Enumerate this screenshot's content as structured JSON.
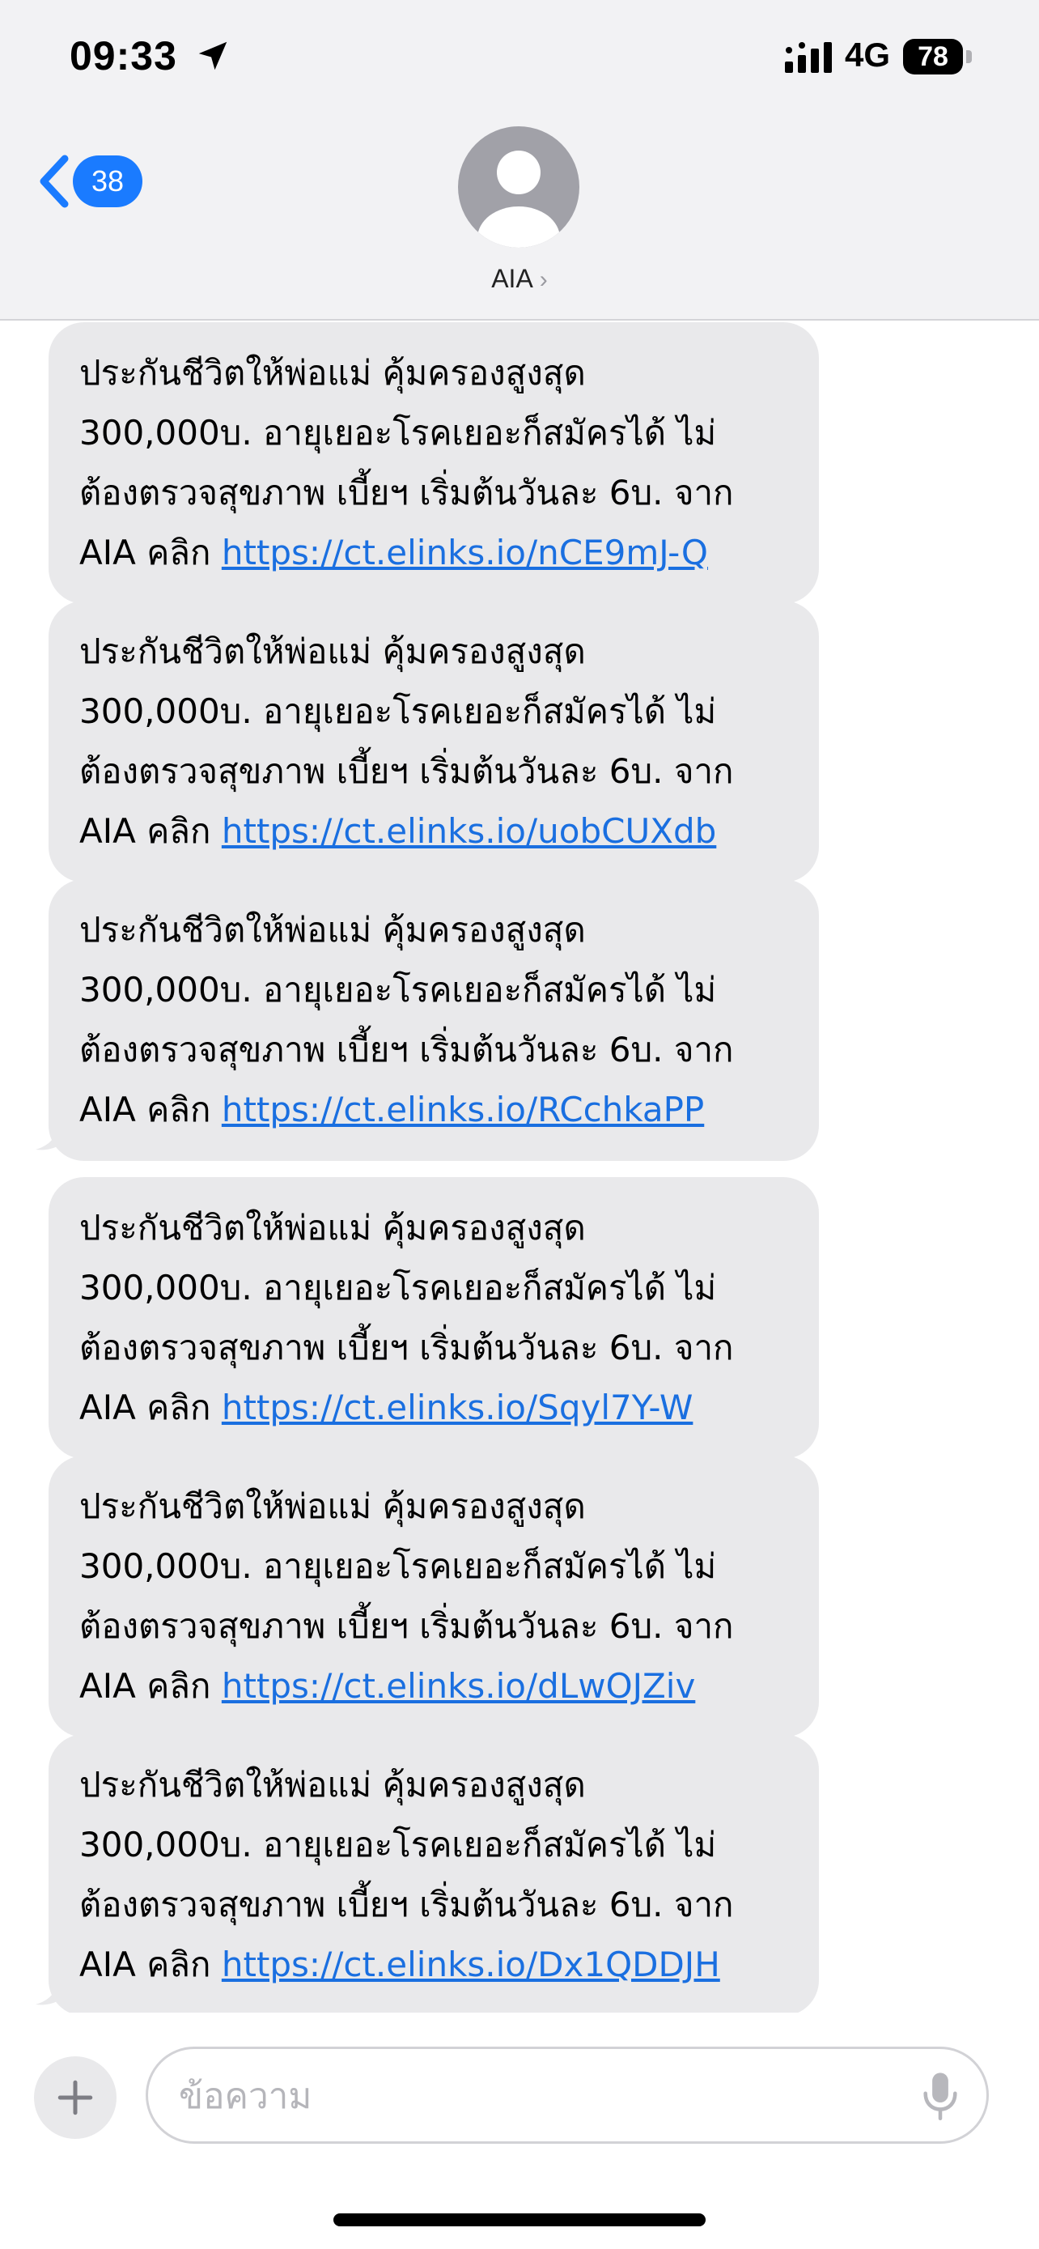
{
  "status_bar": {
    "time": "09:33",
    "network": "4G",
    "battery": "78"
  },
  "header": {
    "back_badge": "38",
    "contact_name": "AIA",
    "contact_chevron": "›"
  },
  "colors": {
    "accent": "#1a7bff",
    "bubble_gray": "#e9e9eb",
    "link": "#1a6fe0"
  },
  "messages": [
    {
      "line1": "ประกันชีวิตให้พ่อแม่ คุ้มครองสูงสุด",
      "line2": "300,000บ. อายุเยอะโรคเยอะก็สมัครได้ ไม่",
      "line3": "ต้องตรวจสุขภาพ เบี้ยฯ เริ่มต้นวันละ 6บ. จาก",
      "prefix": "AIA คลิก ",
      "link": "https://ct.elinks.io/nCE9mJ-Q"
    },
    {
      "line1": "ประกันชีวิตให้พ่อแม่ คุ้มครองสูงสุด",
      "line2": "300,000บ. อายุเยอะโรคเยอะก็สมัครได้ ไม่",
      "line3": "ต้องตรวจสุขภาพ เบี้ยฯ เริ่มต้นวันละ 6บ. จาก",
      "prefix": "AIA คลิก ",
      "link": "https://ct.elinks.io/uobCUXdb"
    },
    {
      "line1": "ประกันชีวิตให้พ่อแม่ คุ้มครองสูงสุด",
      "line2": "300,000บ. อายุเยอะโรคเยอะก็สมัครได้ ไม่",
      "line3": "ต้องตรวจสุขภาพ เบี้ยฯ เริ่มต้นวันละ 6บ. จาก",
      "prefix": "AIA คลิก ",
      "link": "https://ct.elinks.io/RCchkaPP"
    },
    {
      "line1": "ประกันชีวิตให้พ่อแม่ คุ้มครองสูงสุด",
      "line2": "300,000บ. อายุเยอะโรคเยอะก็สมัครได้ ไม่",
      "line3": "ต้องตรวจสุขภาพ เบี้ยฯ เริ่มต้นวันละ 6บ. จาก",
      "prefix": "AIA คลิก ",
      "link": "https://ct.elinks.io/Sqyl7Y-W"
    },
    {
      "line1": "ประกันชีวิตให้พ่อแม่ คุ้มครองสูงสุด",
      "line2": "300,000บ. อายุเยอะโรคเยอะก็สมัครได้ ไม่",
      "line3": "ต้องตรวจสุขภาพ เบี้ยฯ เริ่มต้นวันละ 6บ. จาก",
      "prefix": "AIA คลิก ",
      "link": "https://ct.elinks.io/dLwOJZiv"
    },
    {
      "line1": "ประกันชีวิตให้พ่อแม่ คุ้มครองสูงสุด",
      "line2": "300,000บ. อายุเยอะโรคเยอะก็สมัครได้ ไม่",
      "line3": "ต้องตรวจสุขภาพ เบี้ยฯ เริ่มต้นวันละ 6บ. จาก",
      "prefix": "AIA คลิก ",
      "link": "https://ct.elinks.io/Dx1QDDJH"
    }
  ],
  "input_bar": {
    "placeholder": "ข้อความ",
    "plus_icon": "plus-icon",
    "mic_icon": "microphone-icon"
  }
}
